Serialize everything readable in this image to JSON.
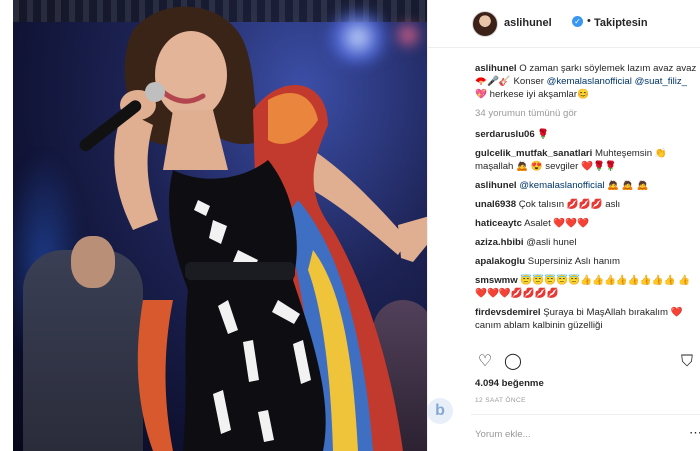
{
  "post": {
    "username": "aslihunel",
    "following_label": "Takiptesin",
    "separator": "•"
  },
  "caption": {
    "user": "aslihunel",
    "text_1": "O zaman şarkı söylemek lazım avaz avaz",
    "emoji_1": "🪭🎤🎸",
    "text_2": "Konser",
    "mention_1": "@kemalaslanofficial",
    "mention_2": "@suat_filiz_",
    "emoji_2": "💖",
    "text_3": "herkese iyi akşamlar",
    "emoji_3": "😊"
  },
  "view_all": "34 yorumun tümünü gör",
  "comments": [
    {
      "user": "serdaruslu06",
      "text": "🌹"
    },
    {
      "user": "gulcelik_mutfak_sanatlari",
      "text": "Muhteşemsin 👏 maşallah 🙇 😍 sevgiler ❤️🌹🌹"
    },
    {
      "user": "aslihunel",
      "text": "@kemalaslanofficial",
      "tail": "🙇 🙇 🙇"
    },
    {
      "user": "unal6938",
      "text": "Çok talısın 💋💋💋 aslı"
    },
    {
      "user": "haticeaytc",
      "text": "Asalet ❤️❤️❤️"
    },
    {
      "user": "aziza.hbibi",
      "text": "@asli hunel"
    },
    {
      "user": "apalakoglu",
      "text": "Supersiniz Aslı hanım"
    },
    {
      "user": "smswmw",
      "text": "😇😇😇😇😇👍👍👍👍👍👍👍👍 👍❤️❤️❤️💋💋💋💋"
    },
    {
      "user": "firdevsdemirel",
      "text": "Şuraya bi MaşAllah bırakalım ❤️ canım ablam kalbinin güzelliği"
    }
  ],
  "likes": "4.094 beğenme",
  "time": "12 SAAT ÖNCE",
  "comment_input": {
    "placeholder": "Yorum ekle..."
  },
  "watermark": "b",
  "icons": {
    "like": "heart-icon",
    "comment": "comment-icon",
    "save": "bookmark-icon",
    "more": "more-icon",
    "verified": "verified-icon"
  },
  "colors": {
    "verified": "#3897f0",
    "mention": "#003569",
    "muted": "#999999"
  }
}
